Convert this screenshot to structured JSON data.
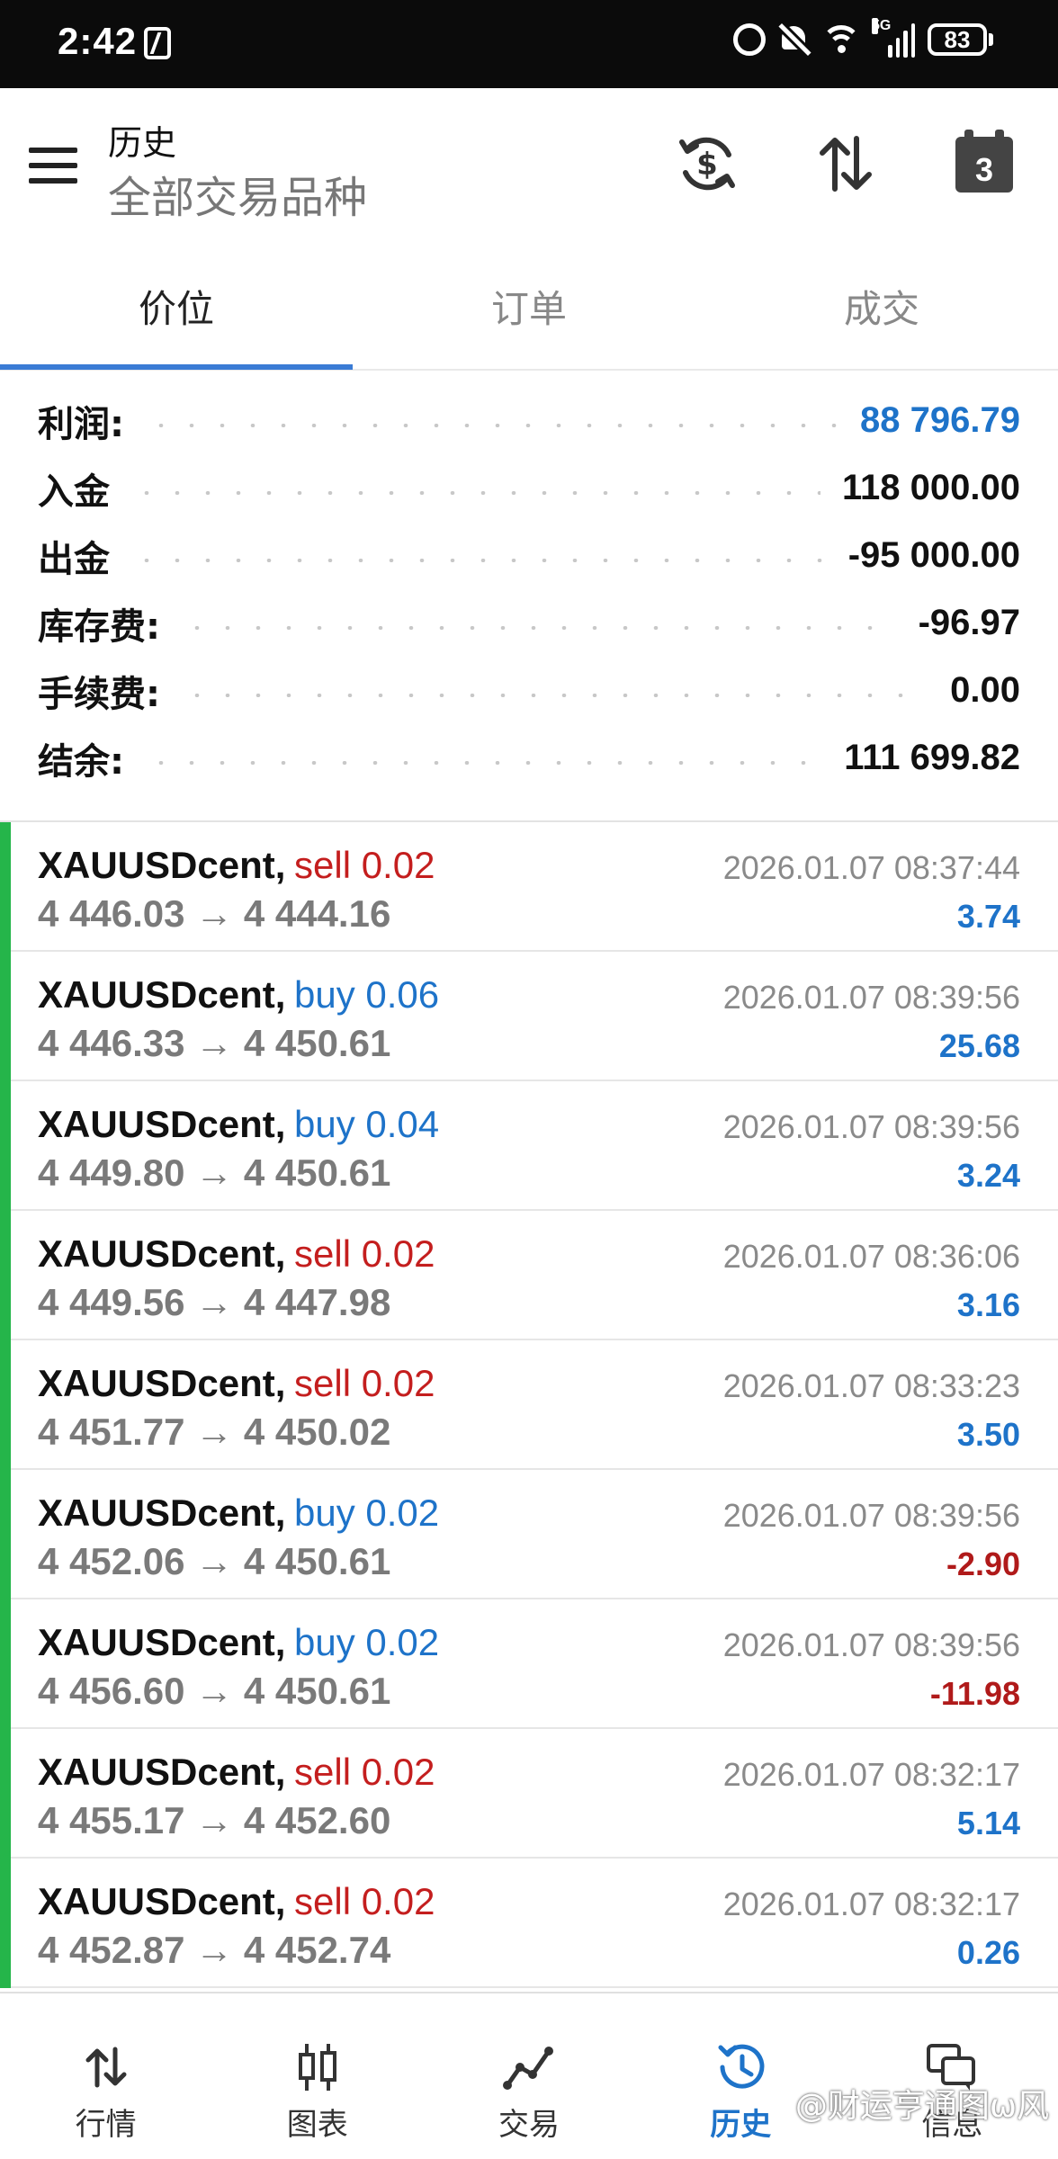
{
  "status_bar": {
    "time": "2:42",
    "battery": "83",
    "network": "5G"
  },
  "header": {
    "title": "历史",
    "subtitle": "全部交易品种",
    "calendar_day": "3"
  },
  "tabs": [
    {
      "label": "价位",
      "active": true
    },
    {
      "label": "订单",
      "active": false
    },
    {
      "label": "成交",
      "active": false
    }
  ],
  "summary": [
    {
      "label": "利润:",
      "value": "88 796.79",
      "highlight": true
    },
    {
      "label": "入金",
      "value": "118 000.00",
      "highlight": false
    },
    {
      "label": "出金",
      "value": "-95 000.00",
      "highlight": false
    },
    {
      "label": "库存费:",
      "value": "-96.97",
      "highlight": false
    },
    {
      "label": "手续费:",
      "value": "0.00",
      "highlight": false
    },
    {
      "label": "结余:",
      "value": "111 699.82",
      "highlight": false
    }
  ],
  "deals": [
    {
      "symbol": "XAUUSDcent,",
      "side": "sell 0.02",
      "prices": "4 446.03 → 4 444.16",
      "time": "2026.01.07 08:37:44",
      "profit": "3.74",
      "negative": false
    },
    {
      "symbol": "XAUUSDcent,",
      "side": "buy 0.06",
      "prices": "4 446.33 → 4 450.61",
      "time": "2026.01.07 08:39:56",
      "profit": "25.68",
      "negative": false
    },
    {
      "symbol": "XAUUSDcent,",
      "side": "buy 0.04",
      "prices": "4 449.80 → 4 450.61",
      "time": "2026.01.07 08:39:56",
      "profit": "3.24",
      "negative": false
    },
    {
      "symbol": "XAUUSDcent,",
      "side": "sell 0.02",
      "prices": "4 449.56 → 4 447.98",
      "time": "2026.01.07 08:36:06",
      "profit": "3.16",
      "negative": false
    },
    {
      "symbol": "XAUUSDcent,",
      "side": "sell 0.02",
      "prices": "4 451.77 → 4 450.02",
      "time": "2026.01.07 08:33:23",
      "profit": "3.50",
      "negative": false
    },
    {
      "symbol": "XAUUSDcent,",
      "side": "buy 0.02",
      "prices": "4 452.06 → 4 450.61",
      "time": "2026.01.07 08:39:56",
      "profit": "-2.90",
      "negative": true
    },
    {
      "symbol": "XAUUSDcent,",
      "side": "buy 0.02",
      "prices": "4 456.60 → 4 450.61",
      "time": "2026.01.07 08:39:56",
      "profit": "-11.98",
      "negative": true
    },
    {
      "symbol": "XAUUSDcent,",
      "side": "sell 0.02",
      "prices": "4 455.17 → 4 452.60",
      "time": "2026.01.07 08:32:17",
      "profit": "5.14",
      "negative": false
    },
    {
      "symbol": "XAUUSDcent,",
      "side": "sell 0.02",
      "prices": "4 452.87 → 4 452.74",
      "time": "2026.01.07 08:32:17",
      "profit": "0.26",
      "negative": false
    }
  ],
  "bottom_nav": [
    {
      "label": "行情",
      "icon": "quotes-icon",
      "active": false
    },
    {
      "label": "图表",
      "icon": "chart-icon",
      "active": false
    },
    {
      "label": "交易",
      "icon": "trade-icon",
      "active": false
    },
    {
      "label": "历史",
      "icon": "history-icon",
      "active": true
    },
    {
      "label": "信息",
      "icon": "messages-icon",
      "active": false
    }
  ],
  "watermark": "@财运亨通图ω风",
  "colors": {
    "accent_blue": "#1e73c9",
    "sell_red": "#c41e1e",
    "loss_red": "#b01a1a",
    "deal_bar_green": "#25b54a",
    "tab_indicator": "#3a7bd5"
  }
}
